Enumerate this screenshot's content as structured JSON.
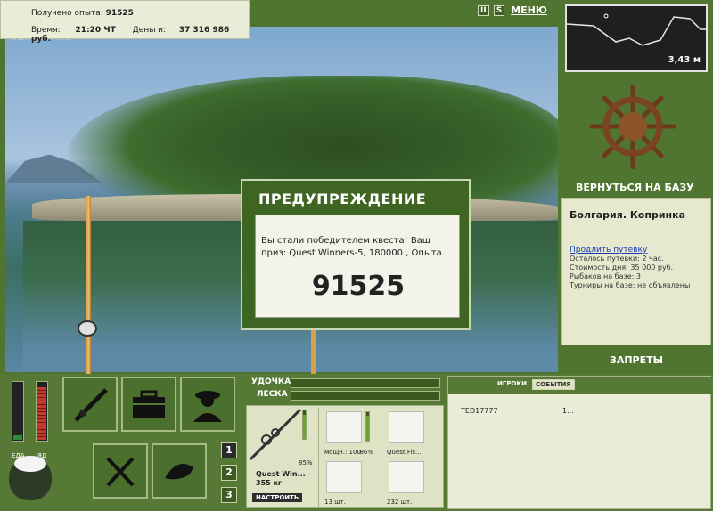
{
  "header": {
    "experience_label": "Получено опыта:",
    "experience_value": "91525",
    "time_label": "Время:",
    "time_value": "21:20 ЧТ",
    "money_label": "Деньги:",
    "money_value": "37 316 986 руб.",
    "watermark": "INSTALLSOFT.RU",
    "pause_label": "II",
    "s_label": "S",
    "menu_label": "МЕНЮ"
  },
  "minimap": {
    "depth": "3,43 м"
  },
  "base": {
    "return_label": "ВЕРНУТЬСЯ НА БАЗУ",
    "location": "Болгария. Копринка",
    "extend_link": "Продлить путевку",
    "rows": [
      "Осталось путевки: 2 час.",
      "Стоимость дня: 35 000 руб.",
      "Рыбаков на базе: 3",
      "Турниры на базе: не объявлены"
    ],
    "bans_label": "ЗАПРЕТЫ"
  },
  "dialog": {
    "title": "ПРЕДУПРЕЖДЕНИЕ",
    "message": "Вы стали победителем квеста! Ваш приз: Quest Winners-5, 180000 , Опыта",
    "value": "91525"
  },
  "status": {
    "food_label": "ЕДА",
    "poison_label": "ЯД",
    "food_level": 0.08,
    "poison_level": 0.9
  },
  "pages": [
    "1",
    "2",
    "3"
  ],
  "gear": {
    "rod_label": "УДОЧКА",
    "line_label": "ЛЕСКА",
    "rod_name": "Quest Win...",
    "rod_weight": "355 кг",
    "rod_condition": "85%",
    "setup_label": "НАСТРОИТЬ",
    "reel_caption": "мощн.: 100",
    "reel_condition": "86%",
    "line_caption": "Quest Fis...",
    "hook_caption": "13 шт.",
    "bait_caption": "232 шт."
  },
  "players": {
    "tab_players": "ИГРОКИ",
    "tab_events": "СОБЫТИЯ",
    "list": [
      {
        "name": "TED17777",
        "value": "1..."
      }
    ]
  },
  "colors": {
    "panel_green": "#4f7530",
    "dialog_green": "#3f6522",
    "panel_light": "#e9ecd7",
    "link_blue": "#1a3bb0"
  }
}
